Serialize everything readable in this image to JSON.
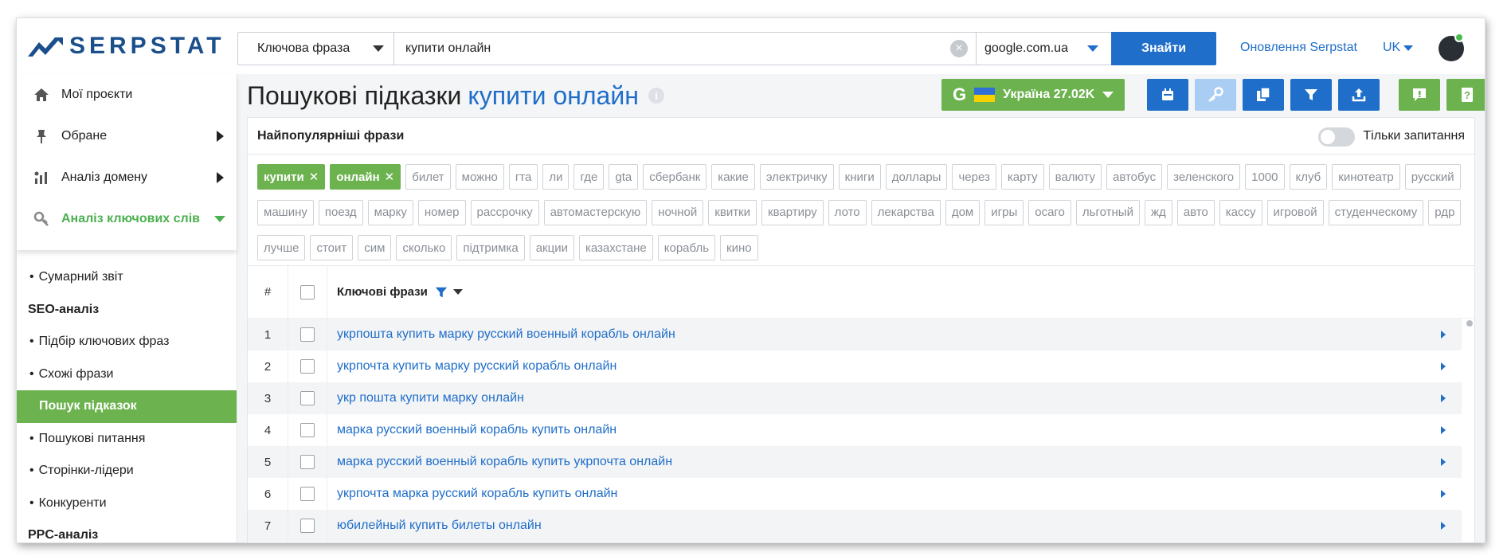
{
  "header": {
    "logo_text": "SERPSTAT",
    "search_type": "Ключова фраза",
    "search_value": "купити онлайн",
    "search_engine": "google.com.ua",
    "find_label": "Знайти",
    "updates_link": "Оновлення Serpstat",
    "language": "UK"
  },
  "sidebar": {
    "main": [
      {
        "label": "Мої проєкти",
        "icon": "home-icon"
      },
      {
        "label": "Обране",
        "icon": "pin-icon"
      },
      {
        "label": "Аналіз домену",
        "icon": "domain-analysis-icon"
      },
      {
        "label": "Аналіз ключових слів",
        "icon": "key-icon"
      }
    ],
    "sub": {
      "summary": "Сумарний звіт",
      "seo_head": "SEO-аналіз",
      "keyword_selection": "Підбір ключових фраз",
      "related": "Схожі фрази",
      "suggestions": "Пошук підказок",
      "questions": "Пошукові питання",
      "top_pages": "Сторінки-лідери",
      "competitors": "Конкуренти",
      "ppc_head": "PPC-аналіз"
    }
  },
  "page": {
    "title": "Пошукові підказки",
    "title_keyword": "купити онлайн",
    "info_symbol": "i",
    "region_label": "Україна 27.02K",
    "region_g": "G"
  },
  "panel": {
    "title": "Найпопулярніші фрази",
    "toggle_label": "Тільки запитання",
    "selected_chips": [
      "купити",
      "онлайн"
    ],
    "chip_remove": "✕",
    "chips": [
      "билет",
      "можно",
      "гта",
      "ли",
      "где",
      "gta",
      "сбербанк",
      "какие",
      "электричку",
      "книги",
      "доллары",
      "через",
      "карту",
      "валюту",
      "автобус",
      "зеленского",
      "1000",
      "клуб",
      "кинотеатр",
      "русский",
      "машину",
      "поезд",
      "марку",
      "номер",
      "рассрочку",
      "автомастерскую",
      "ночной",
      "квитки",
      "квартиру",
      "лото",
      "лекарства",
      "дом",
      "игры",
      "осаго",
      "льготный",
      "жд",
      "авто",
      "кассу",
      "игровой",
      "студенческому",
      "рдр",
      "лучше",
      "стоит",
      "сим",
      "сколько",
      "підтримка",
      "акции",
      "казахстане",
      "корабль",
      "кино"
    ]
  },
  "table": {
    "col_num": "#",
    "col_keywords": "Ключові фрази",
    "rows": [
      {
        "n": "1",
        "kw": "укрпошта купить марку русский военный корабль онлайн"
      },
      {
        "n": "2",
        "kw": "укрпочта купить марку русский корабль онлайн"
      },
      {
        "n": "3",
        "kw": "укр пошта купити марку онлайн"
      },
      {
        "n": "4",
        "kw": "марка русский военный корабль купить онлайн"
      },
      {
        "n": "5",
        "kw": "марка русский военный корабль купить укрпочта онлайн"
      },
      {
        "n": "6",
        "kw": "укрпочта марка русский корабль купить онлайн"
      },
      {
        "n": "7",
        "kw": "юбилейный купить билеты онлайн"
      }
    ]
  },
  "colors": {
    "brand_blue": "#1f6ec9",
    "logo_navy": "#1a4f8b",
    "accent_green": "#6cb34f",
    "chip_text": "#8a8f96"
  }
}
